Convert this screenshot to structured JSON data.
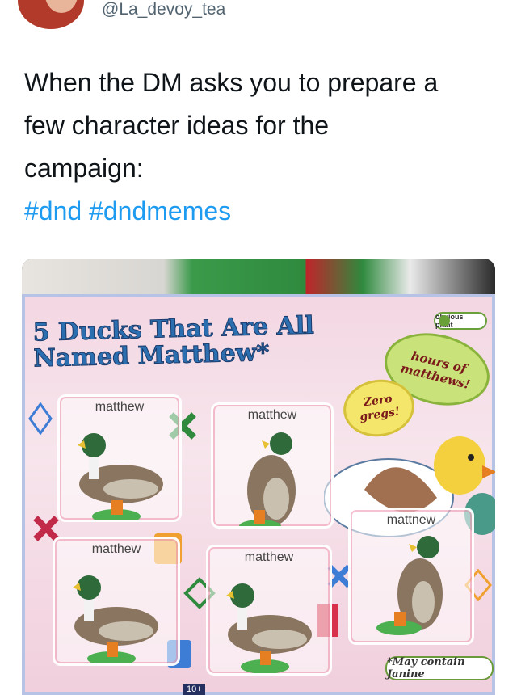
{
  "tweet": {
    "handle": "@La_devoy_tea",
    "lines": [
      "When the DM asks you to prepare a",
      "few character ideas for the",
      "campaign:"
    ],
    "hashtags": "#dnd #dndmemes"
  },
  "photo": {
    "title_line1": "5 Ducks That Are All",
    "title_line2": "Named Matthew*",
    "badge": "obvious plant",
    "bubble_hours": "hours of matthews!",
    "bubble_zero": "Zero gregs!",
    "pack_labels": [
      "matthew",
      "matthew",
      "matthew",
      "matthew",
      "mattnew"
    ],
    "footnote": "*May contain Janine",
    "price_tag": "10+"
  },
  "colors": {
    "hashtag": "#1d9bf0",
    "title": "#2b6fb0"
  }
}
